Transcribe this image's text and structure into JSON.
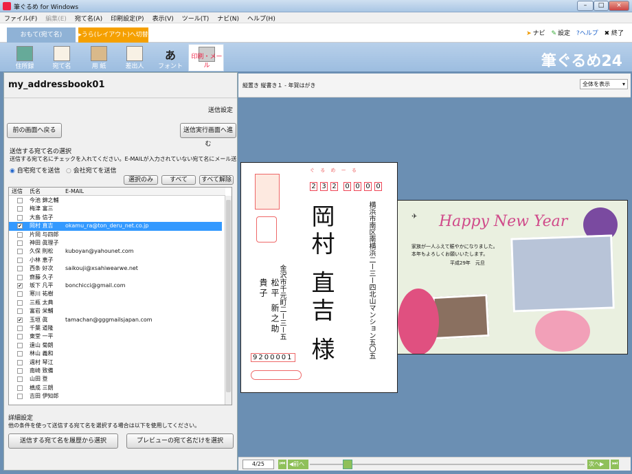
{
  "window": {
    "title": "筆ぐるめ for Windows",
    "min": "–",
    "max": "□",
    "close": "×"
  },
  "menu": [
    "ファイル(F)",
    "編集(E)",
    "宛て名(A)",
    "印刷設定(P)",
    "表示(V)",
    "ツール(T)",
    "ナビ(N)",
    "ヘルプ(H)"
  ],
  "tabs": {
    "front": "おもて(宛て名)",
    "back": "▸うら(レイアウト)へ切替"
  },
  "rtools": {
    "navi": "ナビ",
    "settings": "設定",
    "help": "?ヘルプ",
    "exit": "✖ 終了"
  },
  "toolbar": [
    {
      "label": "住所録",
      "icon": "book-icon"
    },
    {
      "label": "宛て名",
      "icon": "envelope-icon"
    },
    {
      "label": "用 紙",
      "icon": "paper-icon"
    },
    {
      "label": "差出人",
      "icon": "sender-icon"
    },
    {
      "label": "フォント",
      "icon": "font-icon"
    },
    {
      "label": "印刷・メール",
      "icon": "printer-icon"
    }
  ],
  "logo": "筆ぐるめ24",
  "left": {
    "addressbook": "my_addressbook01",
    "sendsettings": "送信設定",
    "back_btn": "前の画面へ戻る",
    "next_btn": "送信実行画面へ進む",
    "select_title": "送信する宛て名の選択",
    "select_desc": "送信する宛て名にチェックを入れてください。E-MAILが入力されていない宛て名にメール送信はできません。",
    "radio_home": "自宅宛てを送信",
    "radio_work": "会社宛てを送信",
    "btn_selonly": "選択のみ",
    "btn_all": "すべて",
    "btn_none": "すべて解除",
    "headers": [
      "送信",
      "氏名",
      "E-MAIL"
    ],
    "rows": [
      {
        "name": "今池 錦之輔",
        "email": "",
        "checked": false
      },
      {
        "name": "梅津 富三",
        "email": "",
        "checked": false
      },
      {
        "name": "大島 信子",
        "email": "",
        "checked": false
      },
      {
        "name": "岡村 直吉",
        "email": "okamu_ra@ton_deru_net.co.jp",
        "checked": true,
        "selected": true
      },
      {
        "name": "片岡 与四郎",
        "email": "",
        "checked": false
      },
      {
        "name": "神田 眞理子",
        "email": "",
        "checked": false
      },
      {
        "name": "久保 則松",
        "email": "kuboyan@yahounet.com",
        "checked": false
      },
      {
        "name": "小林 恵子",
        "email": "",
        "checked": false
      },
      {
        "name": "西条 好次",
        "email": "saikouji@xsahiwearwe.net",
        "checked": false
      },
      {
        "name": "齋藤 久子",
        "email": "",
        "checked": false
      },
      {
        "name": "坂下 凡平",
        "email": "bonchicci@gmail.com",
        "checked": true
      },
      {
        "name": "寒川 祐樹",
        "email": "",
        "checked": false
      },
      {
        "name": "三瓶 太典",
        "email": "",
        "checked": false
      },
      {
        "name": "富岩 栄輔",
        "email": "",
        "checked": false
      },
      {
        "name": "玉垣 眞",
        "email": "tamachan@gggmailsjapan.com",
        "checked": true
      },
      {
        "name": "千葉 道隆",
        "email": "",
        "checked": false
      },
      {
        "name": "東堂 一平",
        "email": "",
        "checked": false
      },
      {
        "name": "遠山 菊朗",
        "email": "",
        "checked": false
      },
      {
        "name": "林山 義和",
        "email": "",
        "checked": false
      },
      {
        "name": "週村 琴江",
        "email": "",
        "checked": false
      },
      {
        "name": "南崎 致備",
        "email": "",
        "checked": false
      },
      {
        "name": "山田 登",
        "email": "",
        "checked": false
      },
      {
        "name": "槙成 三朗",
        "email": "",
        "checked": false
      },
      {
        "name": "吉田 伊知郎",
        "email": "",
        "checked": false
      }
    ],
    "detail_title": "詳細設定",
    "detail_desc": "他の条件を使って送信する宛て名を選択する場合は以下を使用してください。",
    "btn_history": "送信する宛て名を履歴から選択",
    "btn_preview": "プレビューの宛て名だけを選択"
  },
  "right": {
    "header": "縦置き 縦書き１ - 年賀はがき",
    "zoom": "全体を表示",
    "page": "4/25",
    "prev": "前へ",
    "next": "次へ"
  },
  "postcard": {
    "postal_to": [
      "2",
      "3",
      "2",
      "0",
      "0",
      "0",
      "0"
    ],
    "postal_from": "9200001",
    "header": "ぐ る め ー る",
    "address": "横浜市南区南横浜二ー三ー四北山マンション五〇五",
    "name": "岡村 直吉 様",
    "sender_addr": "金沢市千元町二ー三ー五",
    "sender_name": "松平 新之助 貴子"
  },
  "greeting": {
    "title": "Happy New Year",
    "line1": "家族が一人ふえて賑やかになりました。",
    "line2": "本年もよろしくお願いいたします。",
    "date": "平成29年　元旦"
  }
}
